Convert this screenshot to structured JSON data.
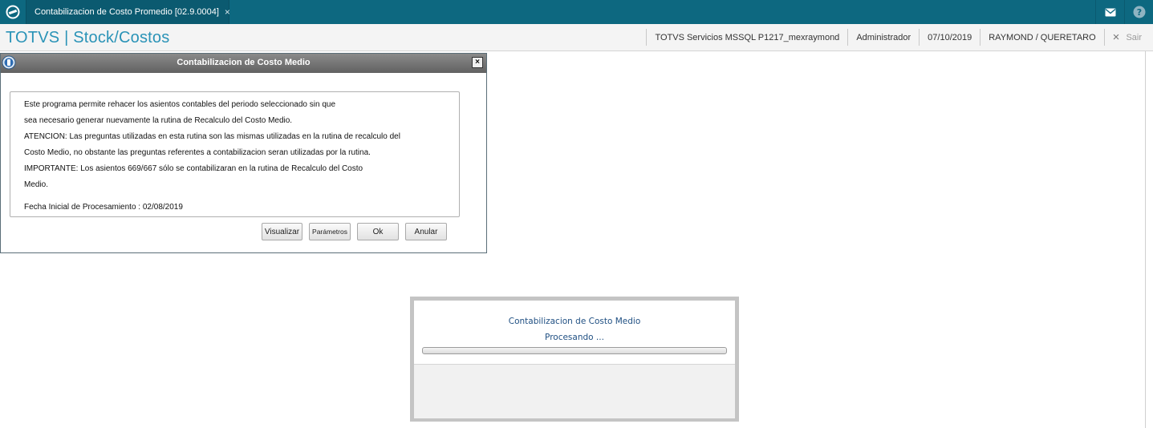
{
  "topbar": {
    "tab_label": "Contabilizacion de Costo Promedio [02.9.0004]",
    "tab_close": "×",
    "logo_icon": "totvs-logo-icon",
    "mail_icon": "mail-icon",
    "help_icon": "help-icon"
  },
  "header": {
    "brand": "TOTVS | Stock/Costos",
    "environment": "TOTVS Servicios MSSQL P1217_mexraymond",
    "user": "Administrador",
    "date": "07/10/2019",
    "branch": "RAYMOND / QUERETARO",
    "exit_label": "Sair",
    "exit_icon": "×"
  },
  "dialog": {
    "title": "Contabilizacion de Costo Medio",
    "close_label": "×",
    "message_lines": [
      "Este programa permite rehacer los asientos contables del periodo seleccionado sin que",
      "sea necesario generar nuevamente la rutina de Recalculo del Costo Medio.",
      "ATENCION: Las preguntas utilizadas en esta rutina son las mismas utilizadas en la rutina de recalculo del",
      "Costo Medio, no obstante las preguntas referentes a contabilizacion seran utilizadas por la rutina.",
      "IMPORTANTE: Los asientos 669/667 sólo se contabilizaran en la rutina de Recalculo del Costo",
      "Medio."
    ],
    "start_date_line": "Fecha Inicial de Procesamiento : 02/08/2019",
    "buttons": {
      "view": "Visualizar",
      "params": "Parámetros",
      "ok": "Ok",
      "cancel": "Anular"
    }
  },
  "processing": {
    "title": "Contabilizacion de Costo Medio",
    "status": "Procesando ...",
    "progress": 0
  },
  "colors": {
    "topbar": "#0d6880",
    "brand": "#2a93b7",
    "processing_text": "#1f4f82"
  }
}
